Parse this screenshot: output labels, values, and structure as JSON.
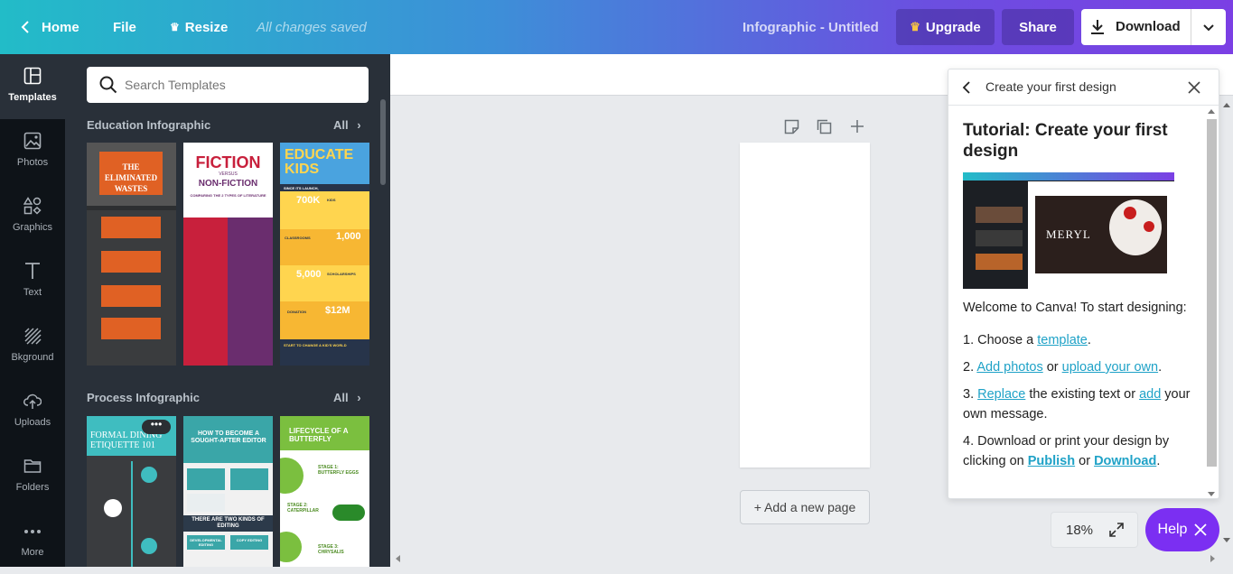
{
  "topbar": {
    "home": "Home",
    "file": "File",
    "resize": "Resize",
    "saved": "All changes saved",
    "doc_title": "Infographic - Untitled",
    "upgrade": "Upgrade",
    "share": "Share",
    "download": "Download"
  },
  "rail": {
    "items": [
      {
        "label": "Templates",
        "icon": "templates-icon"
      },
      {
        "label": "Photos",
        "icon": "photos-icon"
      },
      {
        "label": "Graphics",
        "icon": "graphics-icon"
      },
      {
        "label": "Text",
        "icon": "text-icon"
      },
      {
        "label": "Bkground",
        "icon": "background-icon"
      },
      {
        "label": "Uploads",
        "icon": "uploads-icon"
      },
      {
        "label": "Folders",
        "icon": "folders-icon"
      },
      {
        "label": "More",
        "icon": "more-icon"
      }
    ]
  },
  "panel": {
    "search_placeholder": "Search Templates",
    "section1": {
      "title": "Education Infographic",
      "all": "All"
    },
    "section2": {
      "title": "Process Infographic",
      "all": "All"
    },
    "t1": {
      "title": "THE ELIMINATED WASTES"
    },
    "t2": {
      "title": "FICTION",
      "versus": "VERSUS",
      "sub": "NON-FICTION",
      "tag": "COMPARING THE 2 TYPES OF LITERATURE"
    },
    "t3": {
      "title": "EDUCATE KIDS",
      "since": "SINCE ITS LAUNCH,",
      "n1": "700K",
      "l1": "KIDS",
      "n2": "1,000",
      "l2": "CLASSROOMS",
      "n3": "5,000",
      "l3": "SCHOLARSHIPS",
      "n4": "$12M",
      "l4": "DONATION",
      "footer": "START TO CHANGE A KID'S WORLD"
    },
    "t4": {
      "title": "FORMAL DINING ETIQUETTE 101"
    },
    "t5": {
      "title": "HOW TO BECOME A SOUGHT-AFTER EDITOR",
      "mid": "THERE ARE TWO KINDS OF EDITING",
      "c1": "DEVELOPMENTAL EDITING",
      "c2": "COPY EDITING"
    },
    "t6": {
      "title": "LIFECYCLE OF A BUTTERFLY",
      "s1": "STAGE 1: BUTTERFLY EGGS",
      "s2": "STAGE 2: CATERPILLAR",
      "s3": "STAGE 3: CHRYSALIS"
    }
  },
  "canvas": {
    "add_page": "+ Add a new page"
  },
  "tutorial": {
    "header": "Create your first design",
    "heading": "Tutorial: Create your first design",
    "welcome": "Welcome to Canva! To start designing:",
    "shot_text": "MERYL",
    "step1_pre": "1. Choose a ",
    "step1_link": "template",
    "step1_post": ".",
    "step2_pre": "2. ",
    "step2_link1": "Add photos",
    "step2_mid": " or ",
    "step2_link2": "upload your own",
    "step2_post": ".",
    "step3_pre": "3. ",
    "step3_link1": "Replace",
    "step3_mid": " the existing text or ",
    "step3_link2": "add",
    "step3_post": " your own message.",
    "step4_pre": "4. Download or print your design by clicking on ",
    "step4_link1": "Publish",
    "step4_mid": " or ",
    "step4_link2": "Download",
    "step4_post": "."
  },
  "zoom": {
    "value": "18%"
  },
  "help": {
    "label": "Help"
  },
  "colors": {
    "accent": "#7b2ff2",
    "link": "#1fa2c7",
    "rail": "#0e1318",
    "panel": "#293039"
  }
}
